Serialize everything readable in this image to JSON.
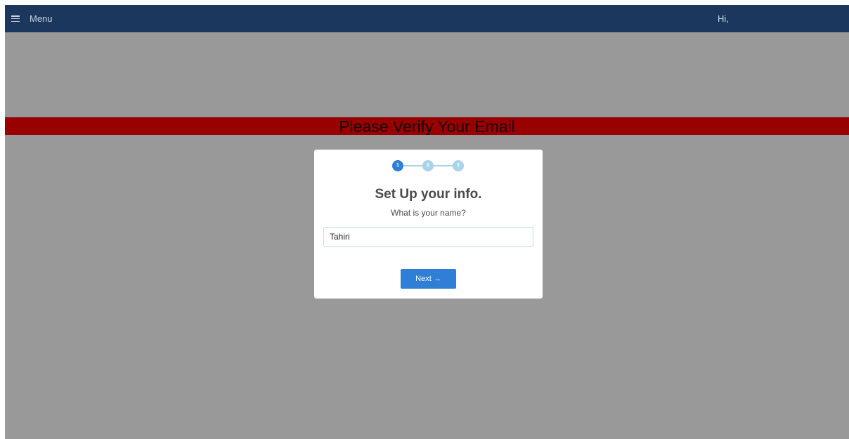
{
  "header": {
    "menu_label": "Menu",
    "greeting": "Hi,"
  },
  "banner": {
    "text": "Please Verify Your Email"
  },
  "setup": {
    "steps": [
      {
        "label": "1",
        "state": "active"
      },
      {
        "label": "2",
        "state": "pending"
      },
      {
        "label": "3",
        "state": "pending"
      }
    ],
    "title": "Set Up your info.",
    "question": "What is your name?",
    "name_value": "Tahiri",
    "next_label": "Next →"
  },
  "colors": {
    "header_bg": "#1c375e",
    "backdrop": "#999999",
    "banner_bg": "#990000",
    "accent": "#2f7fd6",
    "step_pending": "#a9d3e8"
  }
}
